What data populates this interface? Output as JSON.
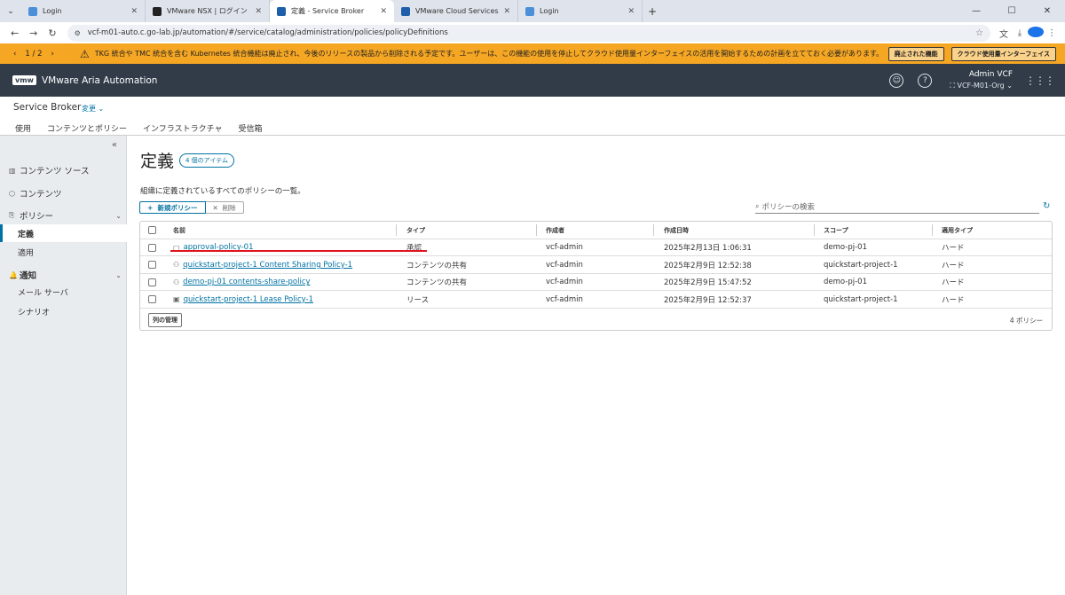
{
  "browser": {
    "tabs": [
      {
        "label": "Login",
        "color": "#4a90d9"
      },
      {
        "label": "VMware NSX | ログイン",
        "color": "#222222"
      },
      {
        "label": "定義 - Service Broker",
        "color": "#1d5fa8"
      },
      {
        "label": "VMware Cloud Services",
        "color": "#1d5fa8"
      },
      {
        "label": "Login",
        "color": "#4a90d9"
      }
    ],
    "active_tab_index": 2,
    "url": "vcf-m01-auto.c.go-lab.jp/automation/#/service/catalog/administration/policies/policyDefinitions"
  },
  "banner": {
    "pager": "1 / 2",
    "message": "TKG 統合や TMC 統合を含む Kubernetes 統合機能は廃止され、今後のリリースの製品から削除される予定です。ユーザーは、この機能の使用を停止してクラウド使用量インターフェイスの活用を開始するための計画を立てておく必要があります。",
    "btn_deprecated": "廃止された機能",
    "btn_cloud": "クラウド使用量インターフェイス",
    "color": "#f5a623"
  },
  "app": {
    "logo": "vmw",
    "name": "VMware Aria Automation",
    "user": "Admin VCF",
    "org": "VCF-M01-Org",
    "header_color": "#313c48"
  },
  "service": {
    "title": "Service Broker",
    "change": "変更",
    "tabs": [
      "使用",
      "コンテンツとポリシー",
      "インフラストラクチャ",
      "受信箱"
    ],
    "active_tab_index": 1
  },
  "sidebar": {
    "content_sources": "コンテンツ ソース",
    "content": "コンテンツ",
    "policies": "ポリシー",
    "definitions": "定義",
    "enforcement": "適用",
    "notifications": "通知",
    "mail_server": "メール サーバ",
    "scenarios": "シナリオ"
  },
  "main": {
    "title": "定義",
    "count_badge": "4 個のアイテム",
    "description": "組織に定義されているすべてのポリシーの一覧。",
    "new_policy": "新規ポリシー",
    "delete": "削除",
    "search_placeholder": "ポリシーの検索",
    "columns": [
      "名前",
      "タイプ",
      "作成者",
      "作成日時",
      "スコープ",
      "適用タイプ"
    ],
    "rows": [
      {
        "name": "approval-policy-01",
        "type": "承認",
        "creator": "vcf-admin",
        "created": "2025年2月13日 1:06:31",
        "scope": "demo-pj-01",
        "enforcement": "ハード",
        "icon": "approval-icon"
      },
      {
        "name": "quickstart-project-1 Content Sharing Policy-1",
        "type": "コンテンツの共有",
        "creator": "vcf-admin",
        "created": "2025年2月9日 12:52:38",
        "scope": "quickstart-project-1",
        "enforcement": "ハード",
        "icon": "share-icon"
      },
      {
        "name": "demo-pj-01 contents-share-policy",
        "type": "コンテンツの共有",
        "creator": "vcf-admin",
        "created": "2025年2月9日 15:47:52",
        "scope": "demo-pj-01",
        "enforcement": "ハード",
        "icon": "share-icon"
      },
      {
        "name": "quickstart-project-1 Lease Policy-1",
        "type": "リース",
        "creator": "vcf-admin",
        "created": "2025年2月9日 12:52:37",
        "scope": "quickstart-project-1",
        "enforcement": "ハード",
        "icon": "lease-icon"
      }
    ],
    "manage_columns": "列の管理",
    "footer_count": "4 ポリシー"
  }
}
